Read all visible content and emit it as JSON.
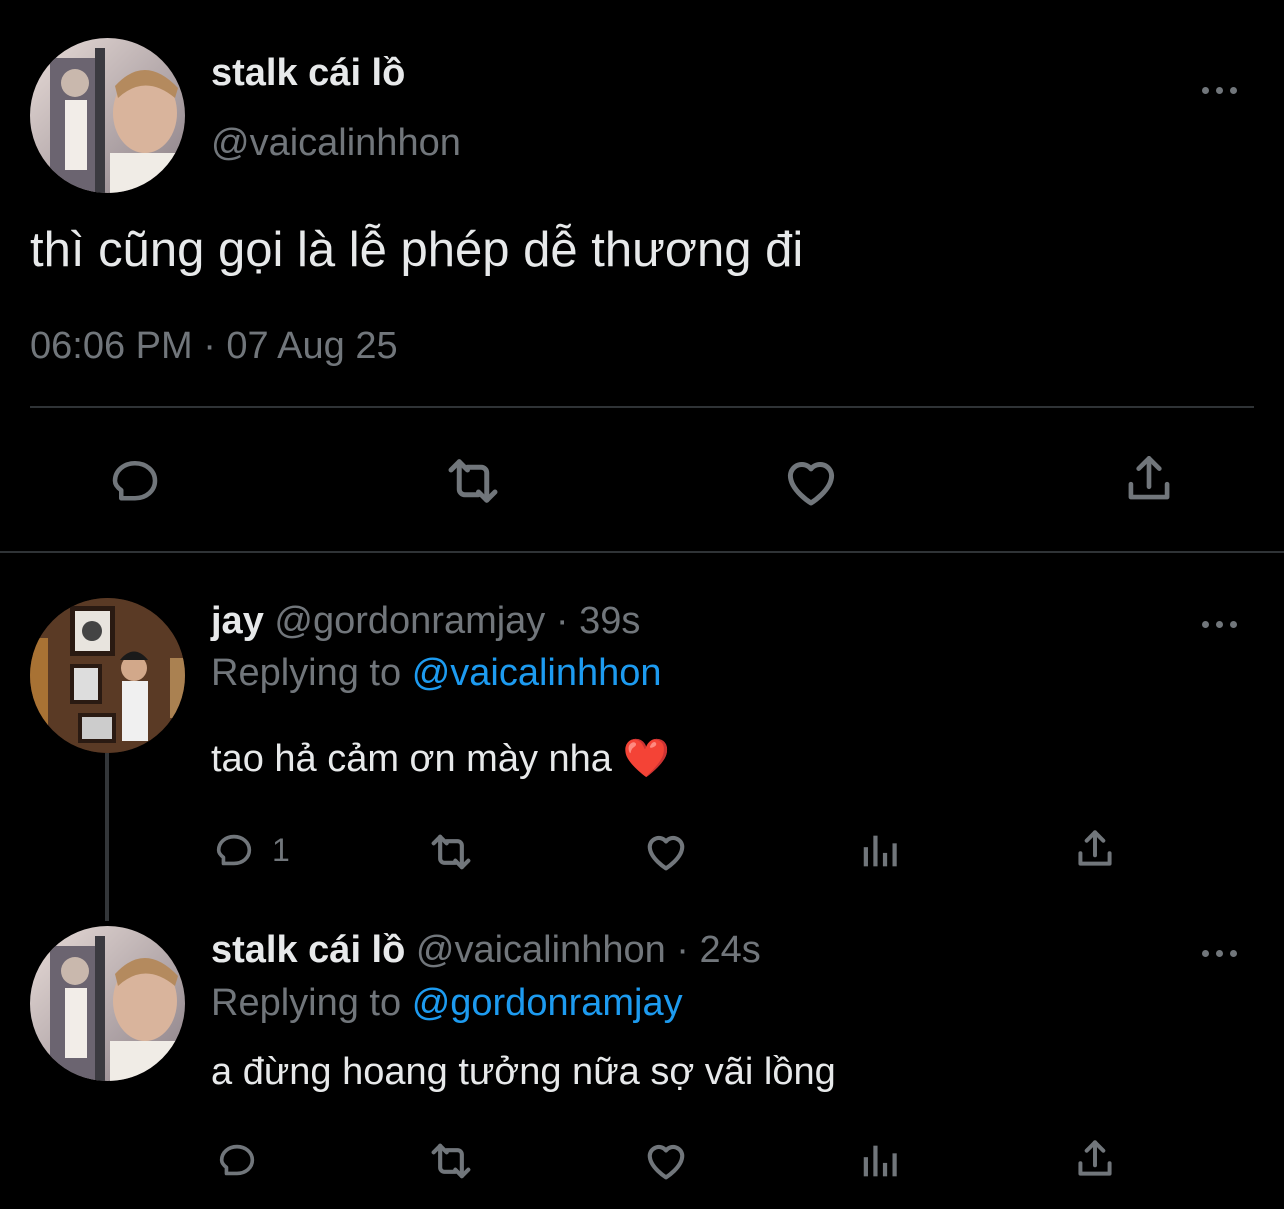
{
  "main_tweet": {
    "display_name": "stalk cái lồ",
    "handle": "@vaicalinhhon",
    "text": "thì cũng gọi là lễ phép dễ thương đi",
    "timestamp": "06:06 PM · 07 Aug 25"
  },
  "replies": [
    {
      "display_name": "jay",
      "handle": "@gordonramjay",
      "time": "· 39s",
      "replying_prefix": "Replying to",
      "replying_to": "@vaicalinhhon",
      "text": "tao hả cảm ơn mày nha ❤️",
      "reply_count": "1"
    },
    {
      "display_name": "stalk cái lồ",
      "handle": "@vaicalinhhon",
      "time": "· 24s",
      "replying_prefix": "Replying to",
      "replying_to": "@gordonramjay",
      "text": "a đừng hoang tưởng nữa sợ vãi lồng",
      "reply_count": ""
    }
  ],
  "icons": [
    "reply-icon",
    "retweet-icon",
    "like-icon",
    "share-icon",
    "analytics-icon",
    "more-icon"
  ],
  "colors": {
    "background": "#000000",
    "text": "#e7e9ea",
    "muted": "#71767b",
    "link": "#1d9bf0",
    "divider": "#2f3336"
  }
}
